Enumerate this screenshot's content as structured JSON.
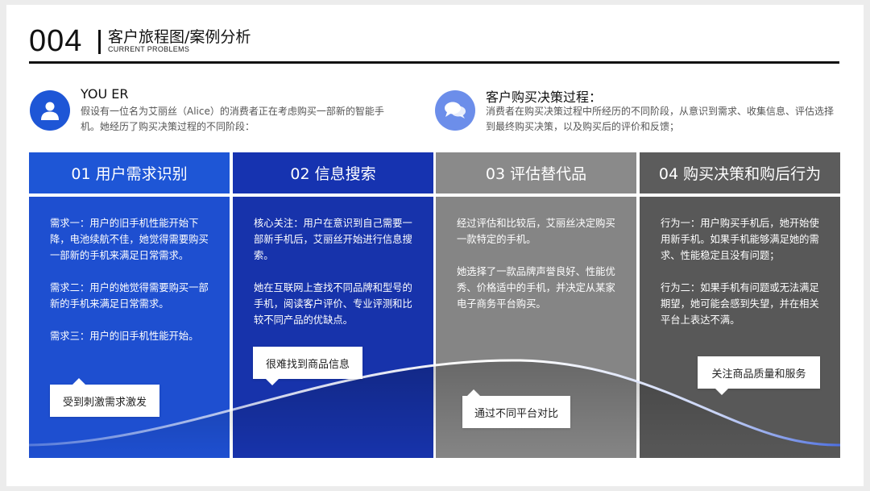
{
  "header": {
    "number": "004",
    "title": "客户旅程图/案例分析",
    "subtitle": "CURRENT PROBLEMS"
  },
  "intro": [
    {
      "icon": "user-icon",
      "title": "YOU ER",
      "text": "假设有一位名为艾丽丝（Alice）的消费者正在考虑购买一部新的智能手机。她经历了购买决策过程的不同阶段："
    },
    {
      "icon": "chat-bubbles-icon",
      "title": "客户购买决策过程：",
      "text": "消费者在购买决策过程中所经历的不同阶段，从意识到需求、收集信息、评估选择到最终购买决策，以及购买后的评价和反馈；"
    }
  ],
  "stages": [
    {
      "title": "01 用户需求识别",
      "paragraphs": [
        "需求一：用户的旧手机性能开始下降，电池续航不佳，她觉得需要购买一部新的手机来满足日常需求。",
        "需求二：用户的她觉得需要购买一部新的手机来满足日常需求。",
        "需求三：用户的旧手机性能开始。"
      ]
    },
    {
      "title": "02 信息搜索",
      "paragraphs": [
        "核心关注：用户在意识到自己需要一部新手机后，艾丽丝开始进行信息搜索。",
        "她在互联网上查找不同品牌和型号的手机，阅读客户评价、专业评测和比较不同产品的优缺点。"
      ]
    },
    {
      "title": "03 评估替代品",
      "paragraphs": [
        "经过评估和比较后，艾丽丝决定购买一款特定的手机。",
        "她选择了一款品牌声誉良好、性能优秀、价格适中的手机，并决定从某家电子商务平台购买。"
      ]
    },
    {
      "title": "04 购买决策和购后行为",
      "paragraphs": [
        "行为一：用户购买手机后，她开始使用新手机。如果手机能够满足她的需求、性能稳定且没有问题；",
        "行为二：如果手机有问题或无法满足期望，她可能会感到失望，并在相关平台上表达不满。"
      ]
    }
  ],
  "callouts": [
    "受到刺激需求激发",
    "很难找到商品信息",
    "通过不同平台对比",
    "关注商品质量和服务"
  ],
  "colors": {
    "stage1_head": "#1e56d6",
    "stage1_body": "#1e4fd0",
    "stage2_head": "#1633b0",
    "stage2_body": "#1733ab",
    "stage3_head": "#8a8a8a",
    "stage3_body": "#858585",
    "stage4_head": "#5c5c5c",
    "stage4_body": "#585858"
  }
}
